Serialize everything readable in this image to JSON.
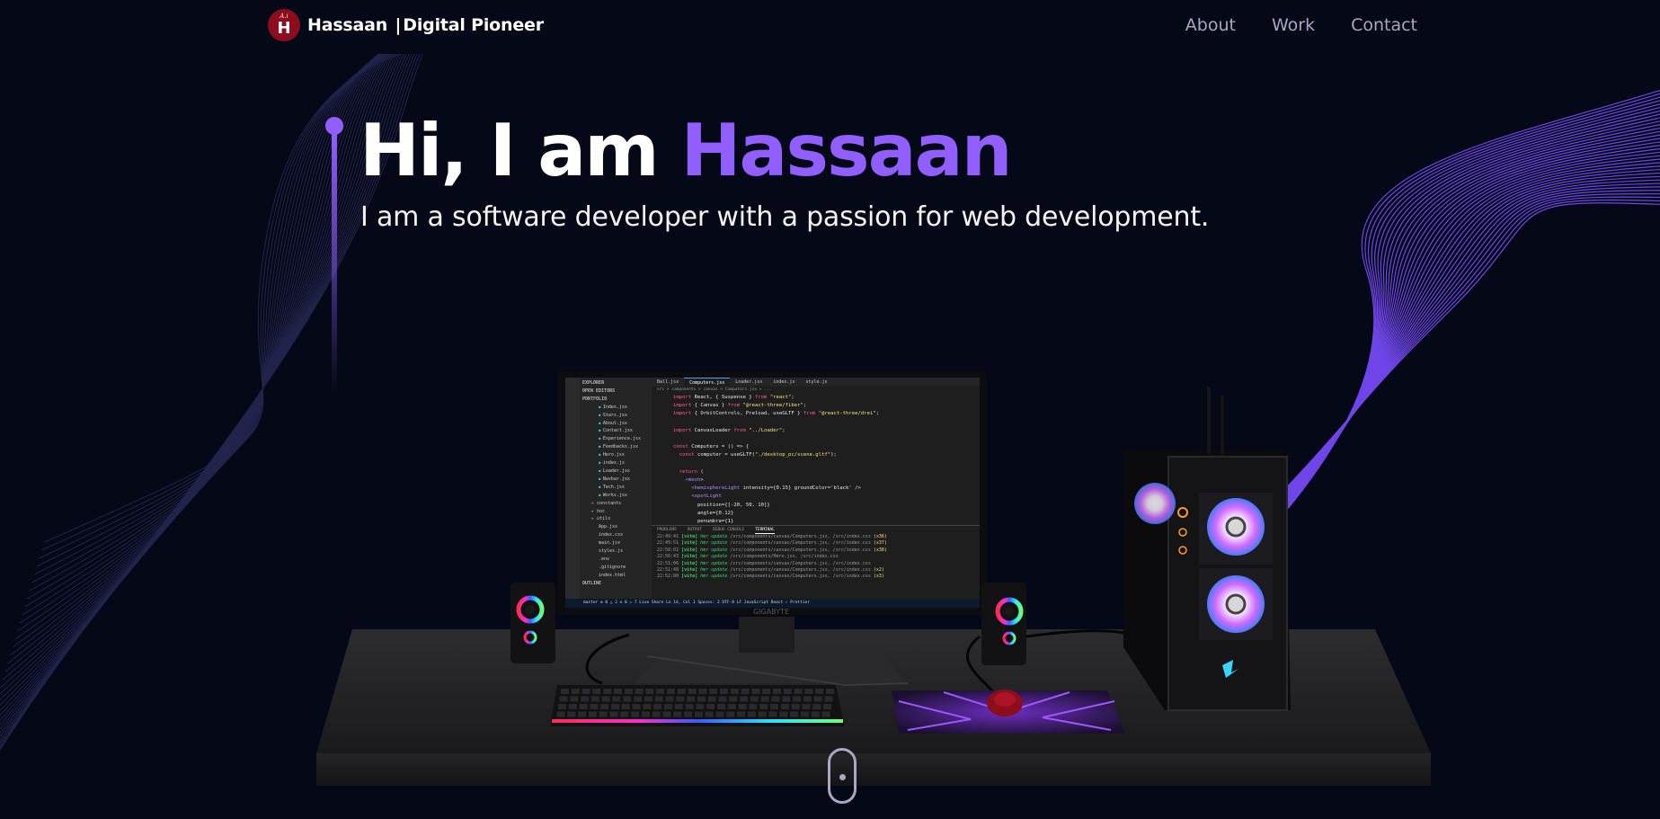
{
  "navbar": {
    "logo": {
      "small": "A.i",
      "big": "H"
    },
    "brand_name": "Hassaan",
    "brand_separator": "|",
    "brand_tagline": "Digital Pioneer",
    "links": [
      "About",
      "Work",
      "Contact"
    ]
  },
  "hero": {
    "greeting": "Hi, I am",
    "name": "Hassaan",
    "subtitle": "I am a software developer with a passion for web development."
  },
  "monitor": {
    "brand": "GIGABYTE",
    "explorer_header": "EXPLORER",
    "open_editors": "OPEN EDITORS",
    "project": "PORTFOLIO",
    "files": [
      "Index.jsx",
      "Stars.jsx",
      "About.jsx",
      "Contact.jsx",
      "Experience.jsx",
      "Feedbacks.jsx",
      "Hero.jsx",
      "index.js",
      "Loader.jsx",
      "Navbar.jsx",
      "Tech.jsx",
      "Works.jsx"
    ],
    "folders": [
      "constants",
      "hoc",
      "utils"
    ],
    "root_files": [
      "App.jsx",
      "index.css",
      "main.jsx",
      "styles.js",
      ".env",
      ".gitignore",
      "index.html"
    ],
    "outline": "OUTLINE",
    "tabs": [
      "Ball.jsx",
      "Computers.jsx",
      "Loader.jsx",
      "index.js",
      "style.js"
    ],
    "breadcrumb": "src > components > canvas > Computers.jsx > ...",
    "code_lines": [
      "import React, { Suspense } from \"react\";",
      "import { Canvas } from \"@react-three/fiber\";",
      "import { OrbitControls, Preload, useGLTF } from \"@react-three/drei\";",
      "",
      "import CanvasLoader from \"../Loader\";",
      "",
      "const Computers = () => {",
      "  const computer = useGLTF(\"./desktop_pc/scene.gltf\");",
      "",
      "  return (",
      "    <mesh>",
      "      <hemisphereLight intensity={0.15} groundColor='black' />",
      "      <spotLight",
      "        position={[-20, 50, 10]}",
      "        angle={0.12}",
      "        penumbra={1}"
    ],
    "panel_tabs": [
      "PROBLEMS",
      "OUTPUT",
      "DEBUG CONSOLE",
      "TERMINAL"
    ],
    "terminal": [
      {
        "time": "22:49:41",
        "file": "/src/components/canvas/Computers.jsx, /src/index.css",
        "count": "(x36)"
      },
      {
        "time": "22:49:51",
        "file": "/src/components/canvas/Computers.jsx, /src/index.css",
        "count": "(x37)"
      },
      {
        "time": "22:50:02",
        "file": "/src/components/canvas/Computers.jsx, /src/index.css",
        "count": "(x38)"
      },
      {
        "time": "22:50:43",
        "file": "/src/components/Hero.jsx, /src/index.css",
        "count": ""
      },
      {
        "time": "22:51:06",
        "file": "/src/components/canvas/Computers.jsx, /src/index.css",
        "count": ""
      },
      {
        "time": "22:51:48",
        "file": "/src/components/canvas/Computers.jsx, /src/index.css",
        "count": "(x2)"
      },
      {
        "time": "22:52:00",
        "file": "/src/components/canvas/Computers.jsx, /src/index.css",
        "count": "(x3)"
      }
    ],
    "terminal_tag": "[vite]",
    "terminal_action": "hmr update",
    "status_bar": "master   ⊗ 0 △ 2   ⊙ 0 ⚠ 7   Live Share            Ln 14, Col 1   Spaces: 2   UTF-8   LF   JavaScript React   ✓ Prettier"
  },
  "colors": {
    "background": "#050816",
    "accent": "#915eff",
    "secondary": "#aaa6c3",
    "logo_red": "#8b0d1e"
  },
  "icons": {
    "logo": "hassaan-logo-icon",
    "scroll": "mouse-scroll-icon"
  }
}
